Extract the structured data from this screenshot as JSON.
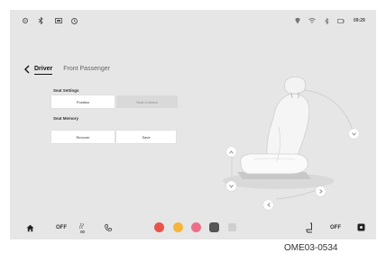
{
  "status_bar": {
    "time": "09:29"
  },
  "tabs": {
    "back_icon": "chevron-left-icon",
    "driver": "Driver",
    "front_passenger": "Front Passenger"
  },
  "seat_settings": {
    "label": "Seat Settings",
    "position": "Position",
    "seat_cushion": "Seat Cushion"
  },
  "seat_memory": {
    "label": "Seat Memory",
    "recover": "Recover",
    "save": "Save"
  },
  "dock": {
    "left_off": "OFF",
    "right_off": "OFF"
  },
  "caption": "OME03-0534"
}
